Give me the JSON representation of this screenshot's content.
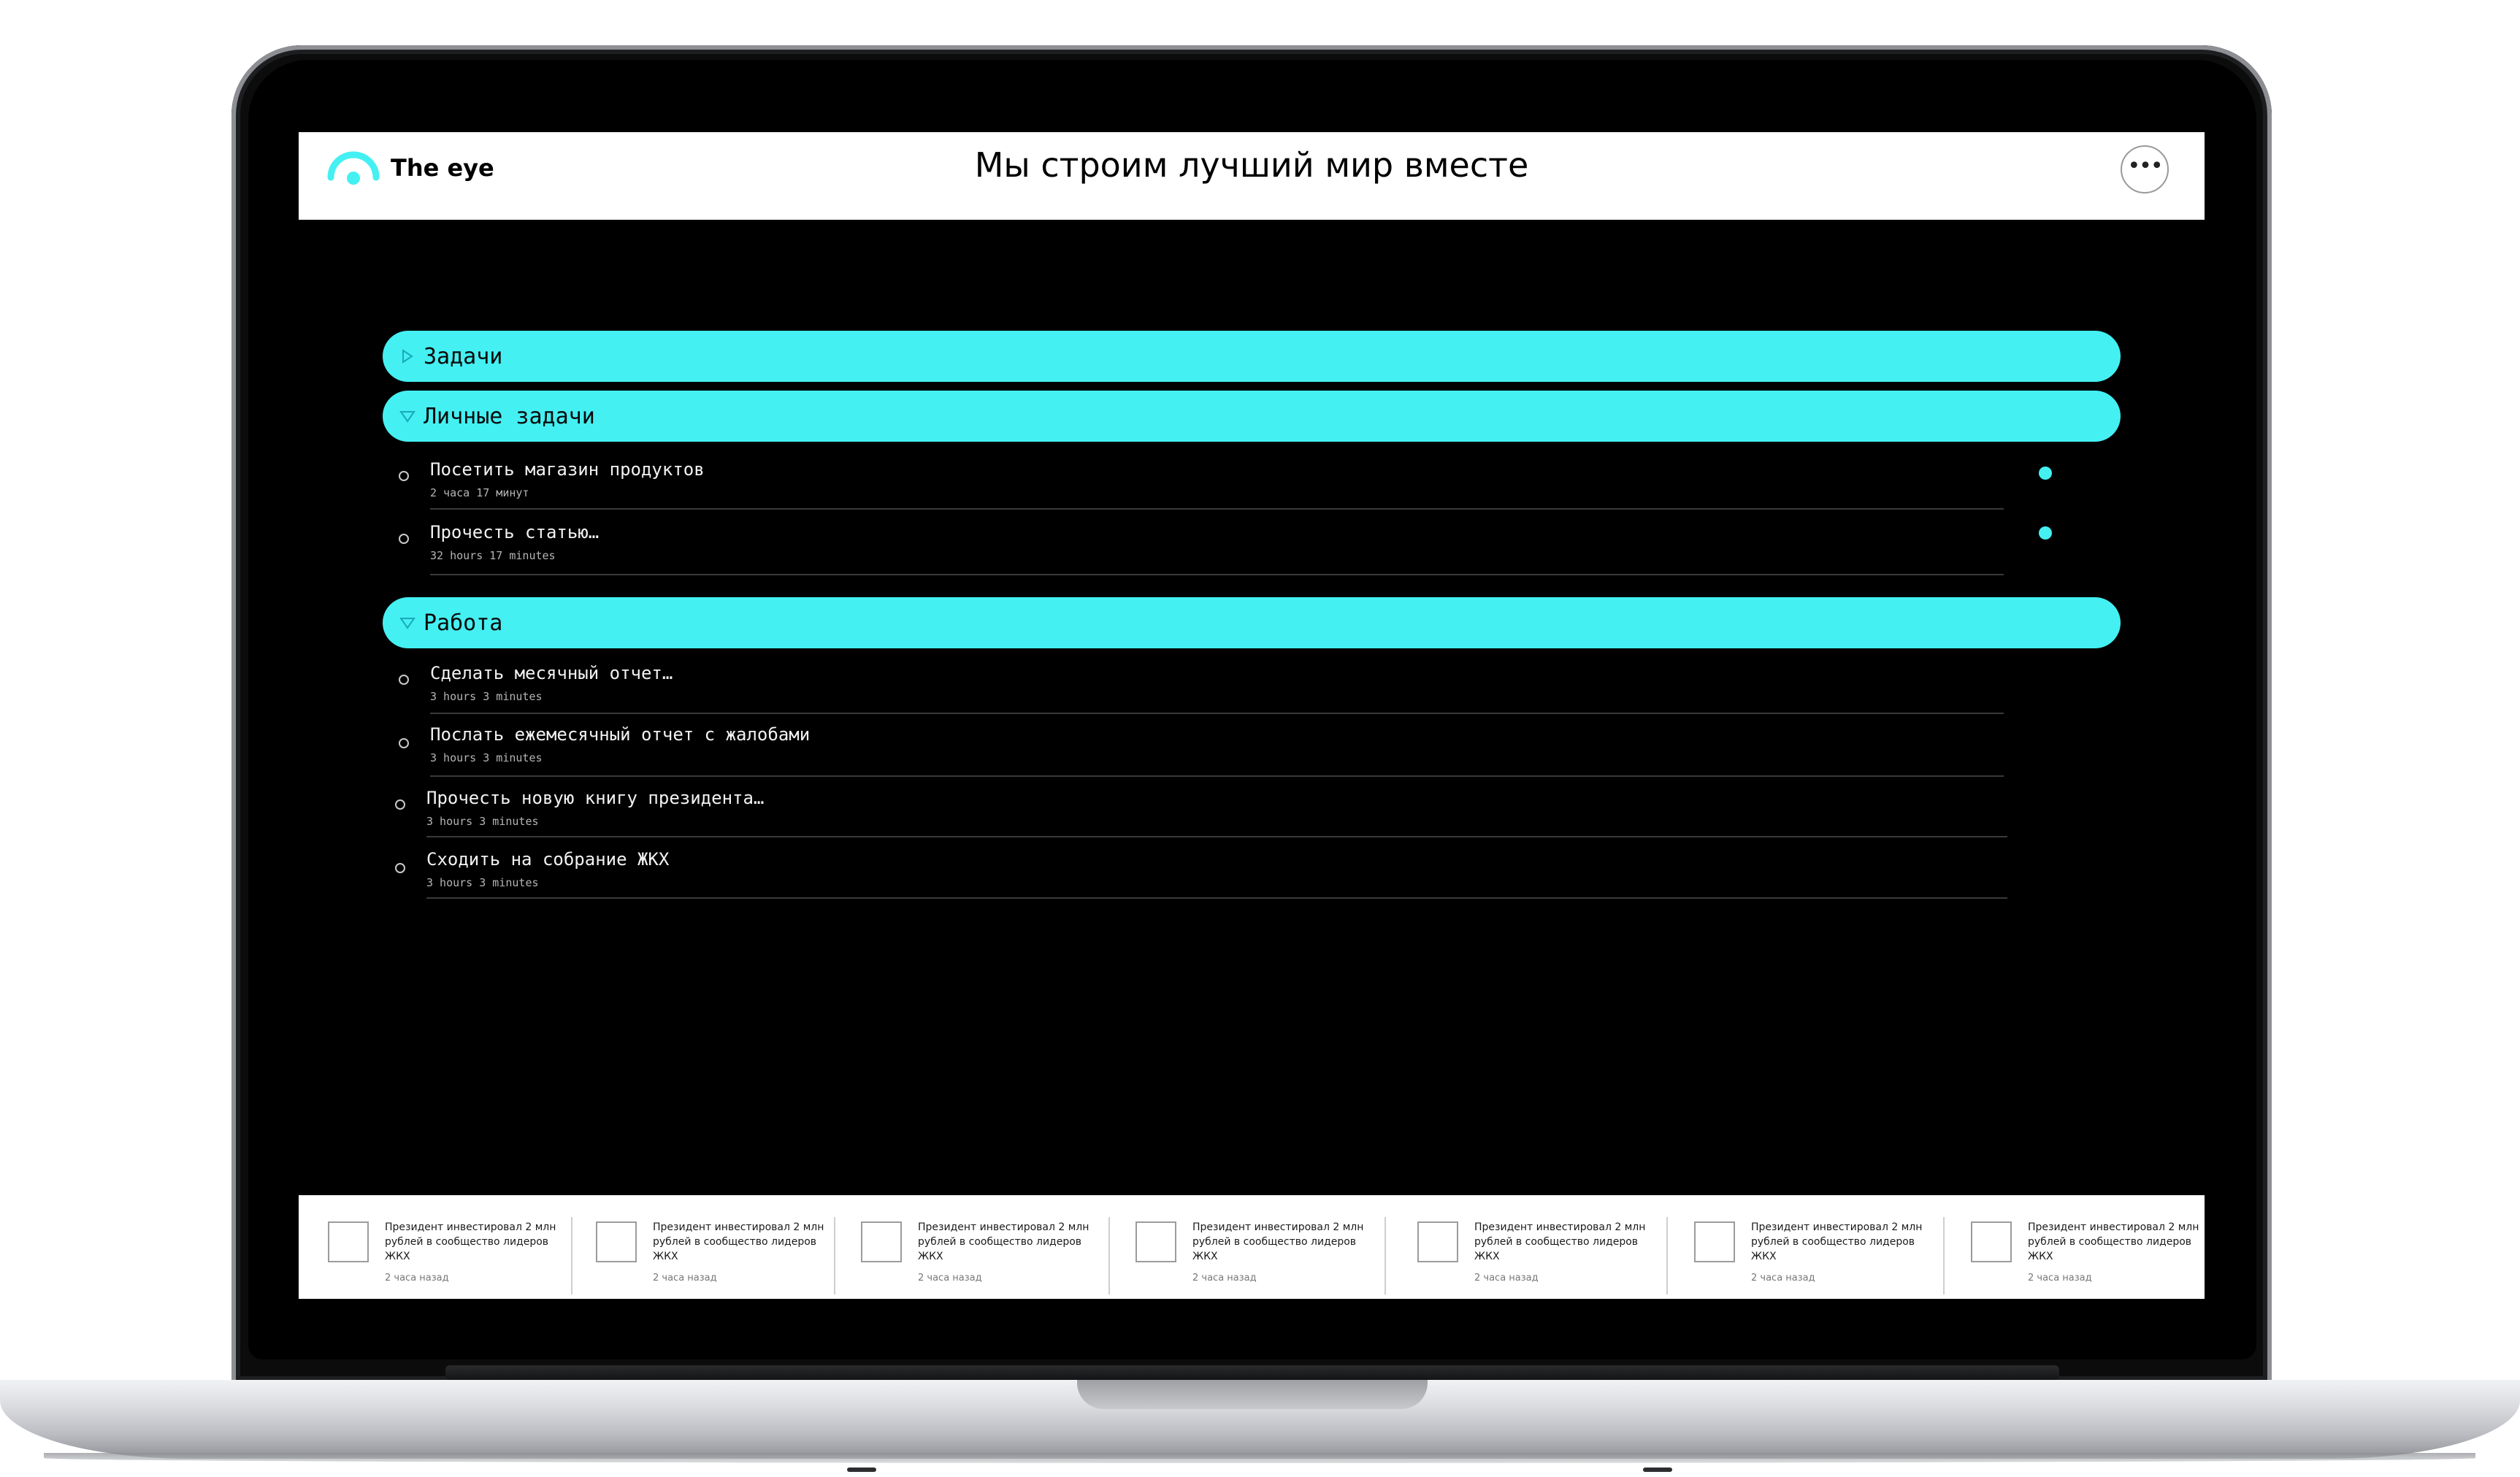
{
  "app": {
    "logo_text": "The eye",
    "brand_color": "#44f0f2",
    "page_title": "Мы строим лучший мир вместе",
    "more_label": "•••"
  },
  "groups": [
    {
      "label": "Задачи",
      "state": "collapsed",
      "caret_icon": "caret-right-icon"
    },
    {
      "label": "Личные задачи",
      "state": "expanded",
      "caret_icon": "caret-down-icon",
      "tasks": [
        {
          "title": "Посетить магазин продуктов",
          "meta": "2 часа 17 минут",
          "unread": true
        },
        {
          "title": "Прочесть статью…",
          "meta": "32 hours 17 minutes",
          "unread": true
        }
      ]
    },
    {
      "label": "Работа",
      "state": "expanded",
      "caret_icon": "caret-down-icon",
      "tasks": [
        {
          "title": "Сделать месячный отчет…",
          "meta": "3 hours 3 minutes"
        },
        {
          "title": "Послать ежемесячный отчет с жалобами",
          "meta": "3 hours 3 minutes"
        },
        {
          "title": "Прочесть новую книгу президента…",
          "meta": "3 hours 3 minutes"
        },
        {
          "title": "Сходить на собрание ЖКХ",
          "meta": "3 hours 3 minutes"
        }
      ]
    }
  ],
  "news": [
    {
      "headline": "Президент инвестировал 2 млн рублей в сообщество лидеров ЖКХ",
      "time": "2 часа назад"
    },
    {
      "headline": "Президент инвестировал 2 млн рублей в сообщество лидеров ЖКХ",
      "time": "2 часа назад"
    },
    {
      "headline": "Президент инвестировал 2 млн рублей в сообщество лидеров ЖКХ",
      "time": "2 часа назад"
    },
    {
      "headline": "Президент инвестировал 2 млн рублей в сообщество лидеров ЖКХ",
      "time": "2 часа назад"
    },
    {
      "headline": "Президент инвестировал 2 млн рублей в сообщество лидеров ЖКХ",
      "time": "2 часа назад"
    },
    {
      "headline": "Президент инвестировал 2 млн рублей в сообщество лидеров ЖКХ",
      "time": "2 часа назад"
    },
    {
      "headline": "Президент инвестировал 2 млн рублей в сообщество лидеров ЖКХ",
      "time": "2 часа назад"
    }
  ]
}
